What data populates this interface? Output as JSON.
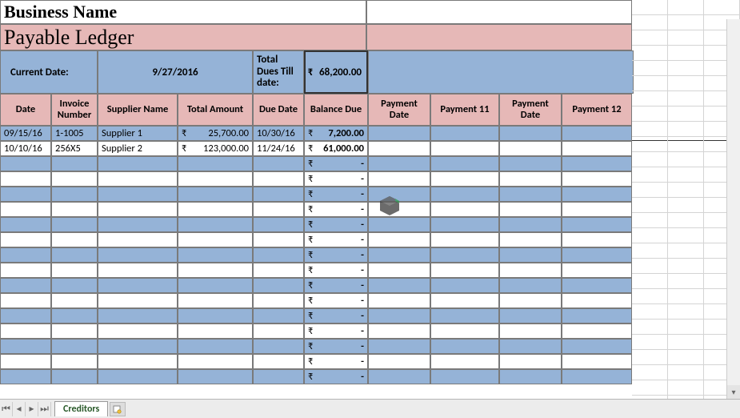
{
  "business_name": "Business Name",
  "title": "Payable Ledger",
  "current_date_label": "Current Date:",
  "current_date": "9/27/2016",
  "total_dues_label": "Total Dues Till date:",
  "total_dues_value": "68,200.00",
  "currency_symbol": "₹",
  "headers": {
    "date": "Date",
    "invoice": "Invoice Number",
    "supplier": "Supplier Name",
    "total_amount": "Total Amount",
    "due_date": "Due Date",
    "balance_due": "Balance Due",
    "payment_date": "Payment Date",
    "payment_11": "Payment 11",
    "payment_date2": "Payment Date",
    "payment_12": "Payment 12"
  },
  "rows": [
    {
      "date": "09/15/16",
      "invoice": "1-1005",
      "supplier": "Supplier 1",
      "amount": "25,700.00",
      "due": "10/30/16",
      "balance": "7,200.00"
    },
    {
      "date": "10/10/16",
      "invoice": "256X5",
      "supplier": "Supplier 2",
      "amount": "123,000.00",
      "due": "11/24/16",
      "balance": "61,000.00"
    },
    {
      "date": "",
      "invoice": "",
      "supplier": "",
      "amount": "",
      "due": "",
      "balance": "-"
    },
    {
      "date": "",
      "invoice": "",
      "supplier": "",
      "amount": "",
      "due": "",
      "balance": "-"
    },
    {
      "date": "",
      "invoice": "",
      "supplier": "",
      "amount": "",
      "due": "",
      "balance": "-"
    },
    {
      "date": "",
      "invoice": "",
      "supplier": "",
      "amount": "",
      "due": "",
      "balance": "-"
    },
    {
      "date": "",
      "invoice": "",
      "supplier": "",
      "amount": "",
      "due": "",
      "balance": "-"
    },
    {
      "date": "",
      "invoice": "",
      "supplier": "",
      "amount": "",
      "due": "",
      "balance": "-"
    },
    {
      "date": "",
      "invoice": "",
      "supplier": "",
      "amount": "",
      "due": "",
      "balance": "-"
    },
    {
      "date": "",
      "invoice": "",
      "supplier": "",
      "amount": "",
      "due": "",
      "balance": "-"
    },
    {
      "date": "",
      "invoice": "",
      "supplier": "",
      "amount": "",
      "due": "",
      "balance": "-"
    },
    {
      "date": "",
      "invoice": "",
      "supplier": "",
      "amount": "",
      "due": "",
      "balance": "-"
    },
    {
      "date": "",
      "invoice": "",
      "supplier": "",
      "amount": "",
      "due": "",
      "balance": "-"
    },
    {
      "date": "",
      "invoice": "",
      "supplier": "",
      "amount": "",
      "due": "",
      "balance": "-"
    },
    {
      "date": "",
      "invoice": "",
      "supplier": "",
      "amount": "",
      "due": "",
      "balance": "-"
    },
    {
      "date": "",
      "invoice": "",
      "supplier": "",
      "amount": "",
      "due": "",
      "balance": "-"
    },
    {
      "date": "",
      "invoice": "",
      "supplier": "",
      "amount": "",
      "due": "",
      "balance": "-"
    }
  ],
  "tab_name": "Creditors",
  "colors": {
    "blue": "#95b3d7",
    "pink": "#e6b8b7"
  }
}
